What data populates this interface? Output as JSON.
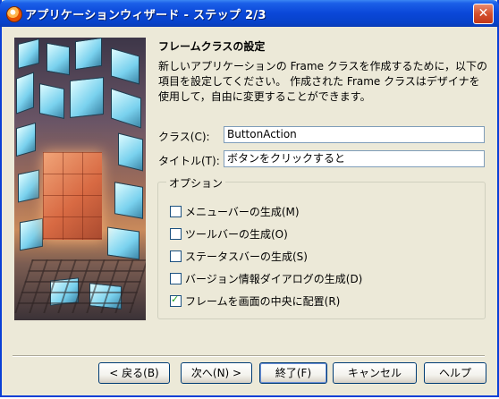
{
  "window": {
    "title": "アプリケーションウィザード - ステップ 2/3"
  },
  "page": {
    "heading": "フレームクラスの設定",
    "description": "新しいアプリケーションの Frame クラスを作成するために，以下の項目を設定してください。 作成された Frame クラスはデザイナを使用して，自由に変更することができます。"
  },
  "form": {
    "class_label": "クラス(C):",
    "class_value": "ButtonAction",
    "title_label": "タイトル(T):",
    "title_value": "ボタンをクリックすると"
  },
  "options": {
    "group_label": "オプション",
    "items": [
      {
        "label": "メニューバーの生成(M)",
        "checked": false
      },
      {
        "label": "ツールバーの生成(O)",
        "checked": false
      },
      {
        "label": "ステータスバーの生成(S)",
        "checked": false
      },
      {
        "label": "バージョン情報ダイアログの生成(D)",
        "checked": false
      },
      {
        "label": "フレームを画面の中央に配置(R)",
        "checked": true
      }
    ]
  },
  "buttons": {
    "back": "< 戻る(B)",
    "next": "次へ(N) >",
    "finish": "終了(F)",
    "cancel": "キャンセル",
    "help": "ヘルプ"
  },
  "colors": {
    "titlebar": "#0a47d8",
    "face": "#ece9d8",
    "border": "#7f9db9"
  }
}
